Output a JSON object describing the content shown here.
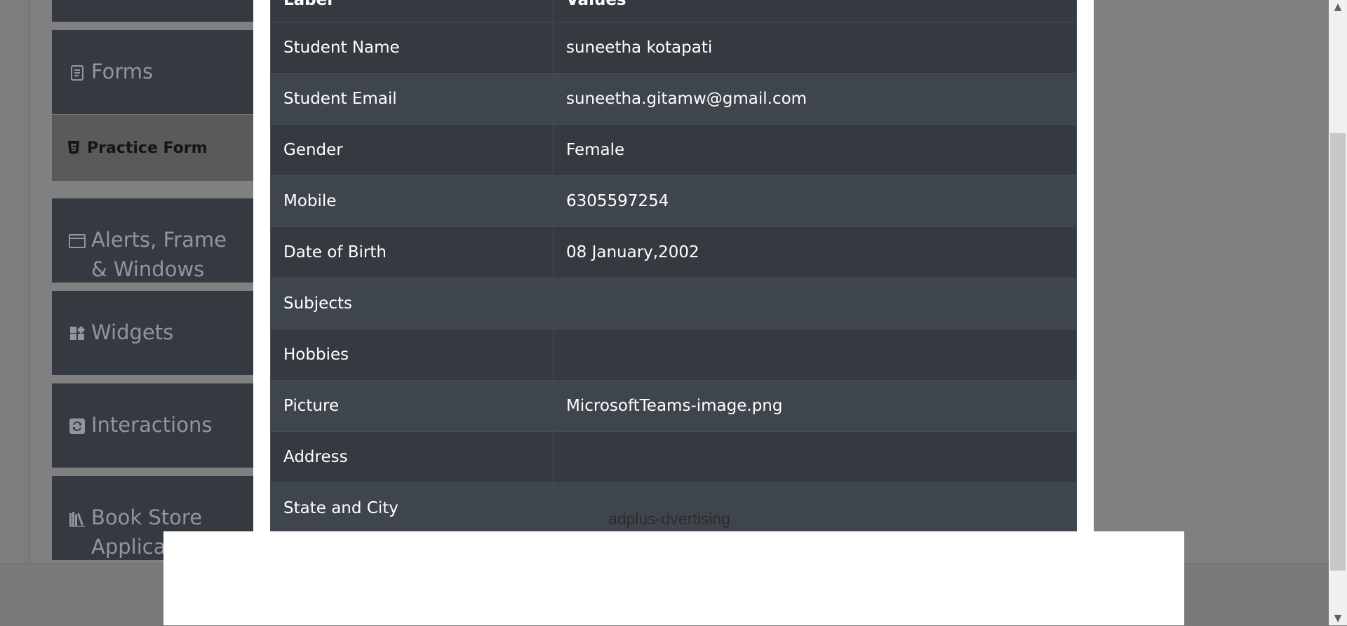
{
  "sidebar": {
    "groups": [
      {
        "label": "Forms",
        "icon": "form-icon"
      },
      {
        "label": "Alerts, Frame & Windows",
        "icon": "window-icon"
      },
      {
        "label": "Widgets",
        "icon": "widgets-icon"
      },
      {
        "label": "Interactions",
        "icon": "interactions-icon"
      },
      {
        "label": "Book Store Application",
        "icon": "books-icon"
      }
    ],
    "active_item": {
      "label": "Practice Form",
      "icon": "html5-icon"
    }
  },
  "modal": {
    "table": {
      "headers": [
        "Label",
        "Values"
      ],
      "rows": [
        {
          "label": "Student Name",
          "value": "suneetha kotapati"
        },
        {
          "label": "Student Email",
          "value": "suneetha.gitamw@gmail.com"
        },
        {
          "label": "Gender",
          "value": "Female"
        },
        {
          "label": "Mobile",
          "value": "6305597254"
        },
        {
          "label": "Date of Birth",
          "value": "08 January,2002"
        },
        {
          "label": "Subjects",
          "value": ""
        },
        {
          "label": "Hobbies",
          "value": ""
        },
        {
          "label": "Picture",
          "value": "MicrosoftTeams-image.png"
        },
        {
          "label": "Address",
          "value": ""
        },
        {
          "label": "State and City",
          "value": ""
        }
      ]
    }
  },
  "ad": {
    "text": "adplus-dvertising"
  },
  "colors": {
    "table_bg": "#343a40",
    "table_striped": "#3f454c",
    "overlay": "#808080"
  }
}
